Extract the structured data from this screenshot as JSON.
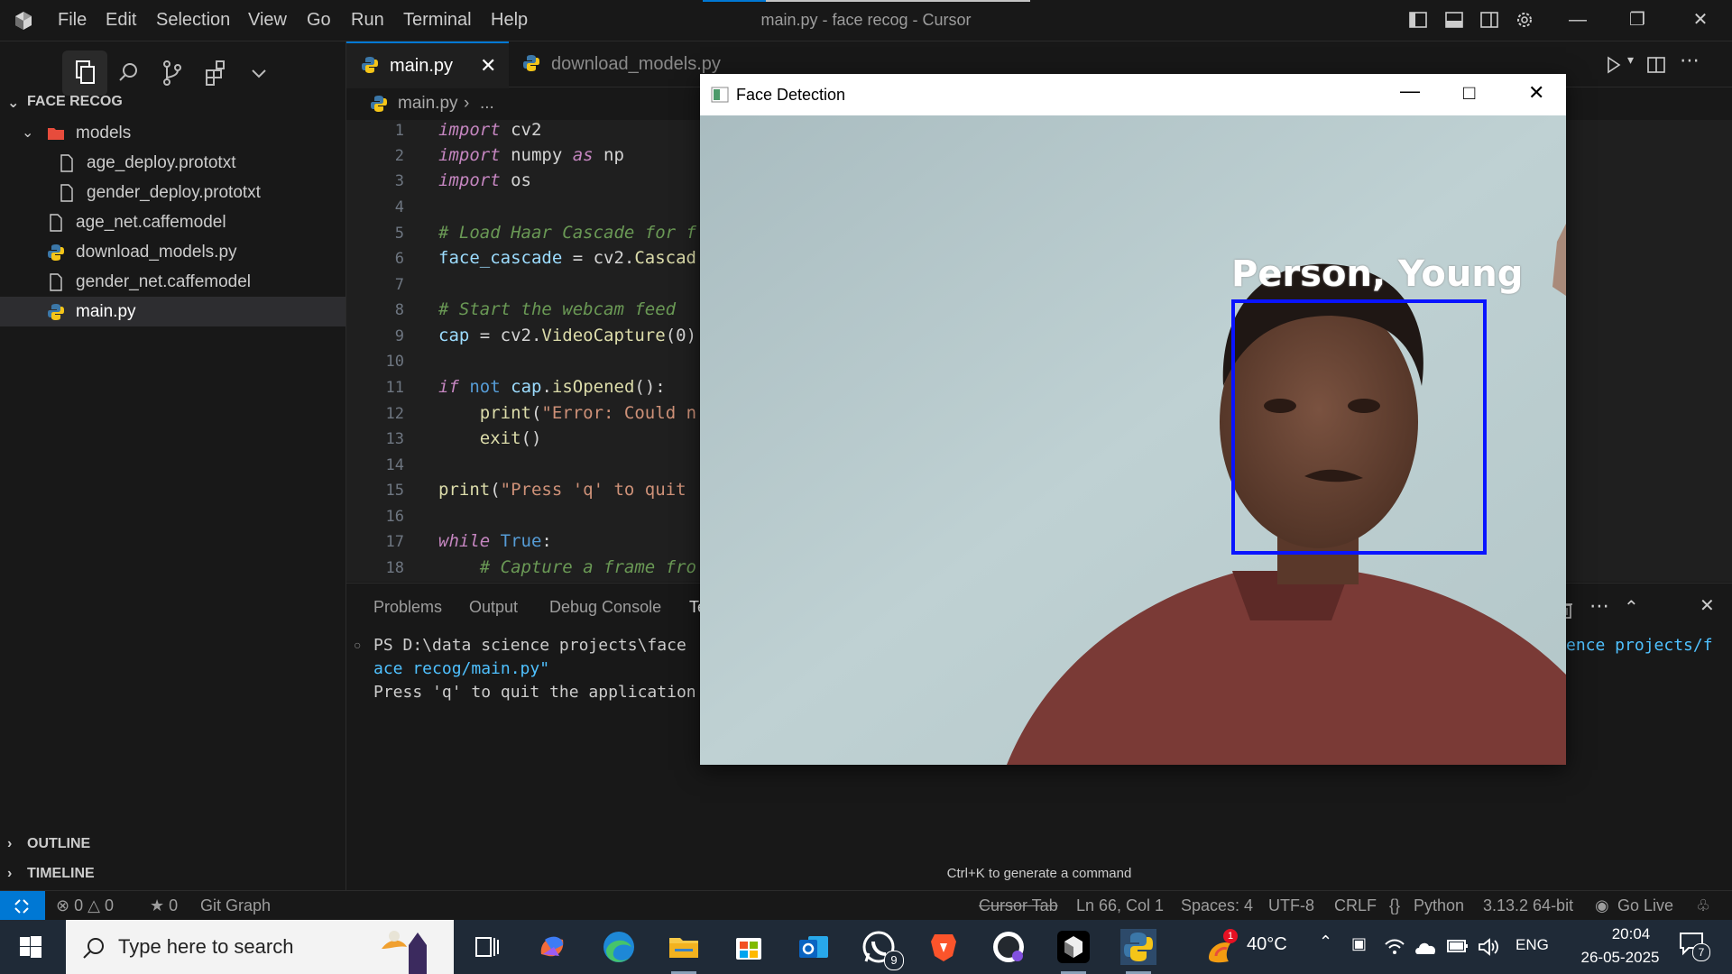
{
  "titlebar": {
    "menus": [
      "File",
      "Edit",
      "Selection",
      "View",
      "Go",
      "Run",
      "Terminal",
      "Help"
    ],
    "title": "main.py - face recog - Cursor"
  },
  "sidebar": {
    "section_title": "FACE RECOG",
    "tree": [
      {
        "label": "models",
        "type": "folder",
        "depth": 0
      },
      {
        "label": "age_deploy.prototxt",
        "type": "file",
        "depth": 1
      },
      {
        "label": "gender_deploy.prototxt",
        "type": "file",
        "depth": 1
      },
      {
        "label": "age_net.caffemodel",
        "type": "file",
        "depth": 0
      },
      {
        "label": "download_models.py",
        "type": "python",
        "depth": 0
      },
      {
        "label": "gender_net.caffemodel",
        "type": "file",
        "depth": 0
      },
      {
        "label": "main.py",
        "type": "python",
        "depth": 0,
        "selected": true
      }
    ],
    "outline": "OUTLINE",
    "timeline": "TIMELINE"
  },
  "editor": {
    "tabs": [
      {
        "label": "main.py",
        "active": true
      },
      {
        "label": "download_models.py",
        "active": false
      }
    ],
    "breadcrumb": {
      "file": "main.py",
      "rest": "..."
    },
    "line_numbers": [
      "1",
      "2",
      "3",
      "4",
      "5",
      "6",
      "7",
      "8",
      "9",
      "10",
      "11",
      "12",
      "13",
      "14",
      "15",
      "16",
      "17",
      "18"
    ]
  },
  "panel": {
    "tabs": [
      "Problems",
      "Output",
      "Debug Console",
      "Te"
    ],
    "terminal_line1": "PS D:\\data science projects\\face",
    "terminal_line1_right": "ence projects/f",
    "terminal_line2": "ace recog/main.py\"",
    "terminal_line3": "Press 'q' to quit the application",
    "hint": "Ctrl+K to generate a command"
  },
  "statusbar": {
    "errors": "0",
    "warnings": "0",
    "ports": "0",
    "git_graph": "Git Graph",
    "cursor_tab": "Cursor Tab",
    "position": "Ln 66, Col 1",
    "spaces": "Spaces: 4",
    "encoding": "UTF-8",
    "eol": "CRLF",
    "language": "Python",
    "interpreter": "3.13.2 64-bit",
    "go_live": "Go Live"
  },
  "face_window": {
    "title": "Face Detection",
    "label": "Person, Young"
  },
  "taskbar": {
    "search_placeholder": "Type here to search",
    "whatsapp_badge": "9",
    "weather_badge": "1",
    "temperature": "40°C",
    "language": "ENG",
    "time": "20:04",
    "date": "26-05-2025",
    "notifications": "7"
  },
  "colors": {
    "accent": "#0078d4",
    "face_box": "#0a14ff"
  }
}
